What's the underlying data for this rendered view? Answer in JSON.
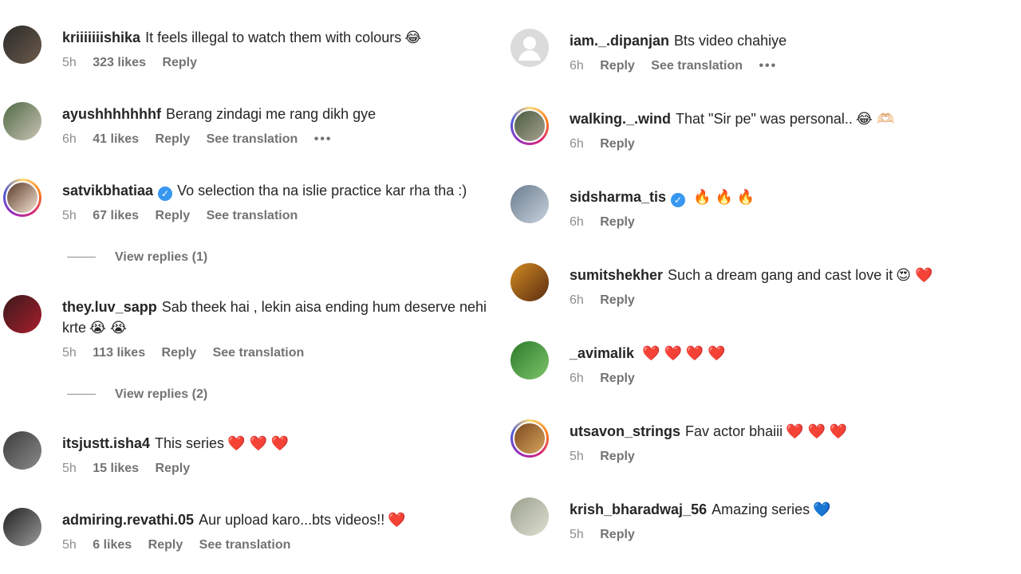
{
  "colors": {
    "accent": "#3897f0",
    "text": "#262626",
    "muted": "#737373"
  },
  "left": [
    {
      "user": "kriiiiiiishika",
      "text": "It feels illegal to watch them with colours",
      "emoji": "😂",
      "time": "5h",
      "likes": "323 likes",
      "reply": "Reply"
    },
    {
      "user": "ayushhhhhhhf",
      "text": "Berang zindagi me rang dikh gye",
      "emoji": "",
      "time": "6h",
      "likes": "41 likes",
      "reply": "Reply",
      "translate": "See translation",
      "more": "•••"
    },
    {
      "user": "satvikbhatiaa",
      "verified": true,
      "text": "Vo selection tha na islie practice kar rha tha :)",
      "emoji": "",
      "time": "5h",
      "likes": "67 likes",
      "reply": "Reply",
      "translate": "See translation",
      "replies": "View replies (1)"
    },
    {
      "user": "they.luv_sapp",
      "text": "Sab theek hai , lekin aisa ending hum deserve nehi krte",
      "emoji": "😭 😭",
      "time": "5h",
      "likes": "113 likes",
      "reply": "Reply",
      "translate": "See translation",
      "replies": "View replies (2)"
    },
    {
      "user": "itsjustt.isha4",
      "text": "This series",
      "emoji": "❤️ ❤️ ❤️",
      "time": "5h",
      "likes": "15 likes",
      "reply": "Reply"
    },
    {
      "user": "admiring.revathi.05",
      "text": "Aur upload karo...bts videos!!",
      "emoji": "❤️",
      "time": "5h",
      "likes": "6 likes",
      "reply": "Reply",
      "translate": "See translation"
    }
  ],
  "right": [
    {
      "user": "iam._.dipanjan",
      "text": "Bts video chahiye",
      "emoji": "",
      "time": "6h",
      "reply": "Reply",
      "translate": "See translation",
      "more": "•••"
    },
    {
      "user": "walking._.wind",
      "text": "That \"Sir pe\" was personal..",
      "emoji": "😂 🫶🏻",
      "time": "6h",
      "reply": "Reply"
    },
    {
      "user": "sidsharma_tis",
      "verified": true,
      "text": "",
      "emoji": "🔥 🔥 🔥",
      "time": "6h",
      "reply": "Reply"
    },
    {
      "user": "sumitshekher",
      "text": "Such a dream gang and cast love it",
      "emoji": "😍 ❤️",
      "time": "6h",
      "reply": "Reply"
    },
    {
      "user": "_avimalik",
      "text": "",
      "emoji": "❤️ ❤️ ❤️ ❤️",
      "time": "6h",
      "reply": "Reply"
    },
    {
      "user": "utsavon_strings",
      "text": "Fav actor bhaiii",
      "emoji": "❤️ ❤️ ❤️",
      "time": "5h",
      "reply": "Reply"
    },
    {
      "user": "krish_bharadwaj_56",
      "text": "Amazing series",
      "emoji": "💙",
      "time": "5h",
      "reply": "Reply"
    }
  ]
}
